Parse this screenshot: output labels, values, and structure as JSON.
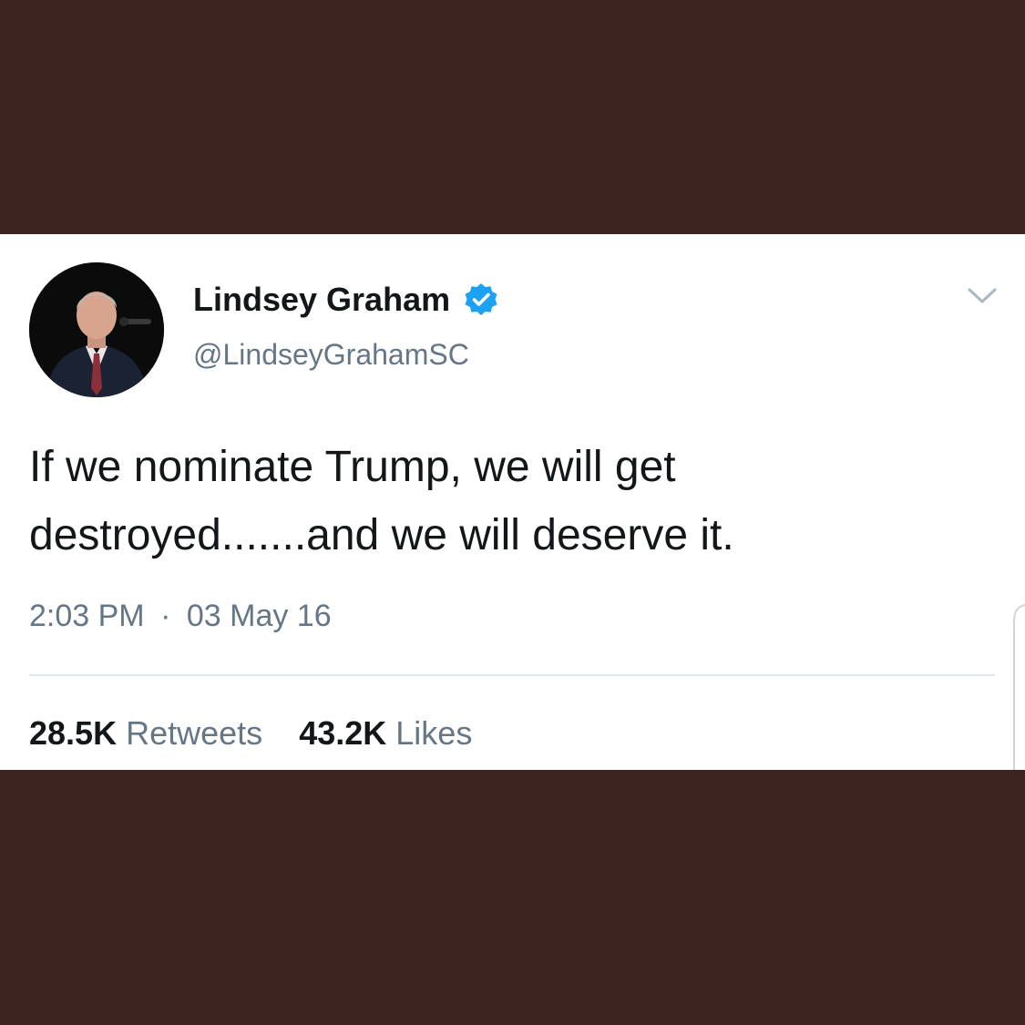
{
  "tweet": {
    "author": {
      "display_name": "Lindsey Graham",
      "handle": "@LindseyGrahamSC",
      "verified": true,
      "avatar_icon": "profile-photo"
    },
    "text_line_1": "If we nominate Trump, we will get",
    "text_line_2": "destroyed.......and we will deserve it.",
    "time": "2:03 PM",
    "separator": "·",
    "date": "03 May 16",
    "retweets": {
      "count": "28.5K",
      "label": "Retweets"
    },
    "likes": {
      "count": "43.2K",
      "label": "Likes"
    }
  },
  "icons": {
    "verified": "verified-badge-icon",
    "menu": "chevron-down-icon"
  },
  "colors": {
    "background_frame": "#3e2421",
    "card": "#ffffff",
    "text_primary": "#14171a",
    "text_secondary": "#657786",
    "verified_blue": "#1da1f2",
    "divider": "#e1e8ed"
  }
}
